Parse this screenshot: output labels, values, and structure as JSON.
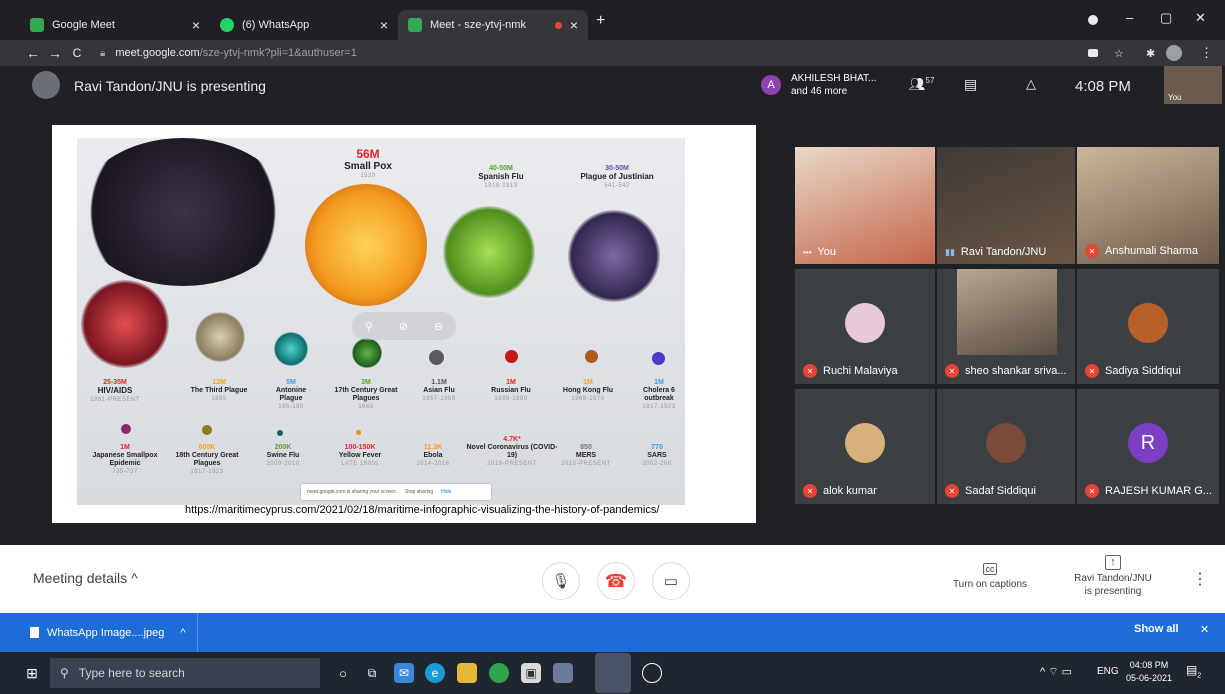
{
  "tabs": [
    {
      "title": "Google Meet",
      "close": "×",
      "fav_color": "#34a853"
    },
    {
      "title": "(6) WhatsApp",
      "close": "×",
      "fav_color": "#25d366"
    },
    {
      "title": "Meet - sze-ytvj-nmk",
      "close": "×",
      "fav_color": "#34a853"
    }
  ],
  "new_tab": "+",
  "window_controls": {
    "minimize": "–",
    "maximize": "▢",
    "close": "✕"
  },
  "address": {
    "back": "←",
    "forward": "→",
    "reload": "C",
    "host": "meet.google.com",
    "path": "/sze-ytvj-nmk?pli=1&authuser=1"
  },
  "meet": {
    "presenting_title": "Ravi Tandon/JNU is presenting",
    "participants_name": "AKHILESH BHAT...",
    "participants_more": "and 46 more",
    "participants_initial": "A",
    "people_count": "57",
    "time": "4:08 PM",
    "self_label": "You"
  },
  "infographic": {
    "items": [
      {
        "value": "56M",
        "name": "Small Pox",
        "years": "1520"
      },
      {
        "value": "40-50M",
        "name": "Spanish Flu",
        "years": "1918-1919"
      },
      {
        "value": "30-50M",
        "name": "Plague of Justinian",
        "years": "541-542"
      },
      {
        "value": "25-35M",
        "name": "HIV/AIDS",
        "years": "1981-PRESENT"
      },
      {
        "value": "12M",
        "name": "The Third Plague",
        "years": "1855"
      },
      {
        "value": "5M",
        "name": "Antonine Plague",
        "years": "165-180"
      },
      {
        "value": "3M",
        "name": "17th Century Great Plagues",
        "years": "1665"
      },
      {
        "value": "1.1M",
        "name": "Asian Flu",
        "years": "1957-1958"
      },
      {
        "value": "1M",
        "name": "Russian Flu",
        "years": "1889-1890"
      },
      {
        "value": "1M",
        "name": "Hong Kong Flu",
        "years": "1968-1970"
      },
      {
        "value": "1M",
        "name": "Cholera 6 outbreak",
        "years": "1817-1923"
      },
      {
        "value": "1M",
        "name": "Japanese Smallpox Epidemic",
        "years": "735-737"
      },
      {
        "value": "600K",
        "name": "18th Century Great Plagues",
        "years": "1817-1923"
      },
      {
        "value": "200K",
        "name": "Swine Flu",
        "years": "2009-2010"
      },
      {
        "value": "100-150K",
        "name": "Yellow Fever",
        "years": "LATE 1800s"
      },
      {
        "value": "11.3K",
        "name": "Ebola",
        "years": "2014-2016"
      },
      {
        "value": "4.7K*",
        "name": "Novel Coronavirus (COVID-19)",
        "years": "2019-PRESENT"
      },
      {
        "value": "850",
        "name": "MERS",
        "years": "2015-PRESENT"
      },
      {
        "value": "770",
        "name": "SARS",
        "years": "2002-200"
      }
    ],
    "share_notice": "meet.google.com is sharing your screen.",
    "stop_sharing": "Stop sharing",
    "hide": "Hide",
    "source_url": "https://maritimecyprus.com/2021/02/18/maritime-infographic-visualizing-the-history-of-pandemics/"
  },
  "participants": [
    {
      "name": "You",
      "muted": false
    },
    {
      "name": "Ravi Tandon/JNU",
      "muted": false
    },
    {
      "name": "Anshumali Sharma",
      "muted": true
    },
    {
      "name": "Ruchi Malaviya",
      "muted": true
    },
    {
      "name": "sheo shankar sriva...",
      "muted": true
    },
    {
      "name": "Sadiya Siddiqui",
      "muted": true
    },
    {
      "name": "alok kumar",
      "muted": true
    },
    {
      "name": "Sadaf Siddiqui",
      "muted": true
    },
    {
      "name": "RAJESH KUMAR G...",
      "muted": true
    }
  ],
  "rajesh_initial": "R",
  "bottom": {
    "meeting_details": "Meeting details",
    "captions": "Turn on captions",
    "presenting_line1": "Ravi Tandon/JNU",
    "presenting_line2": "is presenting",
    "more": "⋮"
  },
  "download": {
    "file": "WhatsApp Image....jpeg",
    "show_all": "Show all",
    "close": "✕"
  },
  "taskbar": {
    "search": "Type here to search",
    "lang": "ENG",
    "time": "04:08 PM",
    "date": "05-06-2021",
    "notif_count": "2"
  }
}
